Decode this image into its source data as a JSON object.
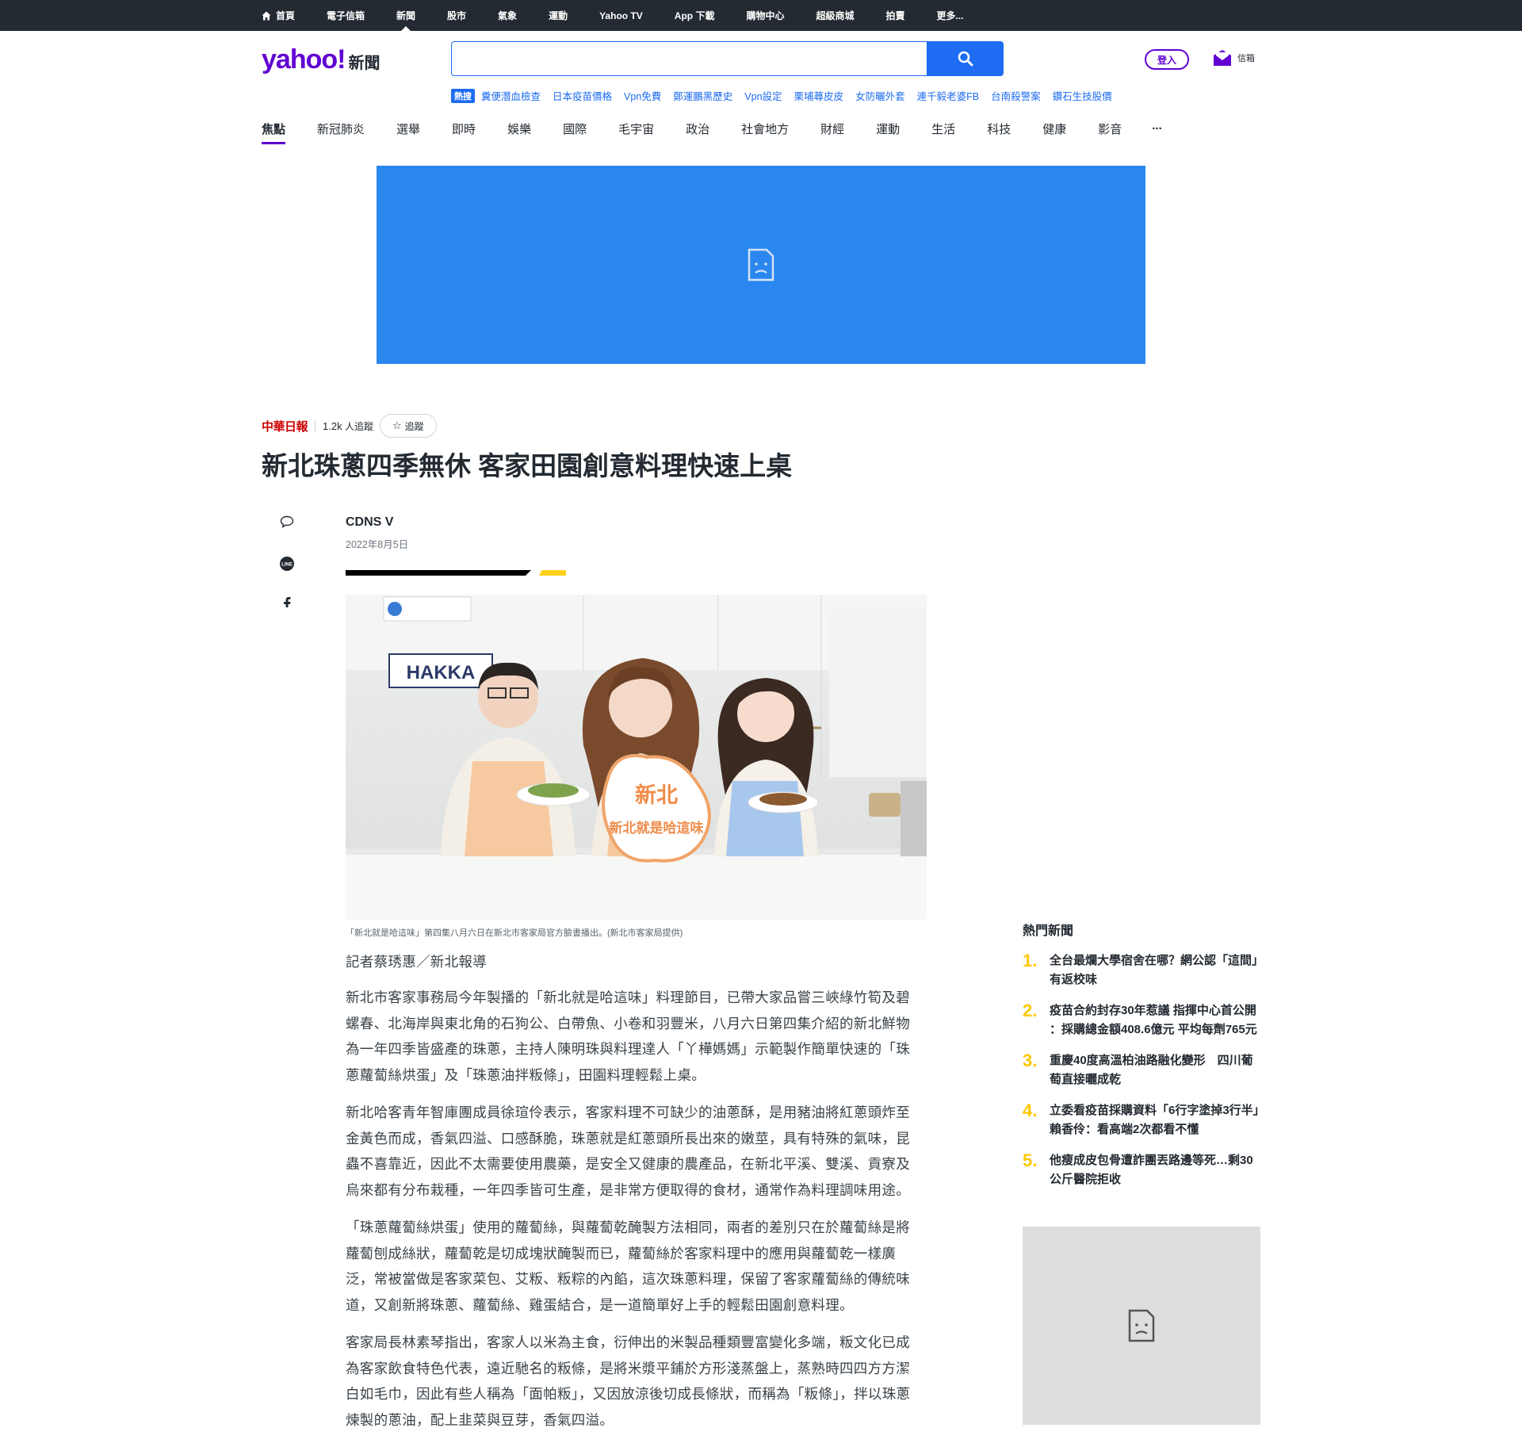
{
  "topnav": {
    "items": [
      "首頁",
      "電子信箱",
      "新聞",
      "股市",
      "氣象",
      "運動",
      "Yahoo TV",
      "App 下載",
      "購物中心",
      "超級商城",
      "拍賣",
      "更多..."
    ],
    "active_index": 2
  },
  "header": {
    "logo_yahoo": "yahoo!",
    "logo_section": "新聞",
    "search_placeholder": "",
    "login_label": "登入",
    "mail_label": "信箱"
  },
  "trending": {
    "badge": "熱搜",
    "links": [
      "糞便潛血檢查",
      "日本疫苗價格",
      "Vpn免費",
      "鄭運鵬黑歷史",
      "Vpn設定",
      "栗埔蕁皮皮",
      "女防曬外套",
      "連千毅老婆FB",
      "台南殺警案",
      "鑽石生技股價"
    ]
  },
  "categories": {
    "items": [
      "焦點",
      "新冠肺炎",
      "選舉",
      "即時",
      "娛樂",
      "國際",
      "毛宇宙",
      "政治",
      "社會地方",
      "財經",
      "運動",
      "生活",
      "科技",
      "健康",
      "影音"
    ],
    "active_index": 0,
    "more": "..."
  },
  "article": {
    "source_logo": "中華日報",
    "followers_count": "1.2k",
    "followers_suffix": "人追蹤",
    "follow_label": "追蹤",
    "headline": "新北珠蔥四季無休 客家田園創意料理快速上桌",
    "author": "CDNS V",
    "date": "2022年8月5日",
    "photo_sign_text": "HAKKA",
    "photo_board_text": "新北就是哈這味",
    "caption": "「新北就是哈這味」第四集八月六日在新北市客家局官方臉書播出。(新北市客家局提供)",
    "byline": "記者蔡琇惠／新北報導",
    "paragraphs": [
      "新北市客家事務局今年製播的「新北就是哈這味」料理節目，已帶大家品嘗三峽綠竹筍及碧螺春、北海岸與東北角的石狗公、白帶魚、小卷和羽豐米，八月六日第四集介紹的新北鮮物為一年四季皆盛產的珠蔥，主持人陳明珠與料理達人「丫樺媽媽」示範製作簡單快速的「珠蔥蘿蔔絲烘蛋」及「珠蔥油拌粄條」，田園料理輕鬆上桌。",
      "新北哈客青年智庫團成員徐瑄伶表示，客家料理不可缺少的油蔥酥，是用豬油將紅蔥頭炸至金黃色而成，香氣四溢、口感酥脆，珠蔥就是紅蔥頭所長出來的嫩莖，具有特殊的氣味，昆蟲不喜靠近，因此不太需要使用農藥，是安全又健康的農產品，在新北平溪、雙溪、貢寮及烏來都有分布栽種，一年四季皆可生產，是非常方便取得的食材，通常作為料理調味用途。",
      "「珠蔥蘿蔔絲烘蛋」使用的蘿蔔絲，與蘿蔔乾醃製方法相同，兩者的差別只在於蘿蔔絲是將蘿蔔刨成絲狀，蘿蔔乾是切成塊狀醃製而已，蘿蔔絲於客家料理中的應用與蘿蔔乾一樣廣泛，常被當做是客家菜包、艾粄、粄粽的內餡，這次珠蔥料理，保留了客家蘿蔔絲的傳統味道，又創新將珠蔥、蘿蔔絲、雞蛋結合，是一道簡單好上手的輕鬆田園創意料理。",
      "客家局長林素琴指出，客家人以米為主食，衍伸出的米製品種類豐富變化多端，粄文化已成為客家飲食特色代表，遠近馳名的粄條，是將米漿平鋪於方形淺蒸盤上，蒸熟時四四方方潔白如毛巾，因此有些人稱為「面帕粄」，又因放涼後切成長條狀，而稱為「粄條」，拌以珠蔥煉製的蔥油，配上韭菜與豆芽，香氣四溢。"
    ]
  },
  "popular": {
    "title": "熱門新聞",
    "items": [
      {
        "num": "1.",
        "text": "全台最爛大學宿舍在哪？網公認「這間」有返校味"
      },
      {
        "num": "2.",
        "text": "疫苗合約封存30年惹議 指揮中心首公開 ：採購總金額408.6億元 平均每劑765元"
      },
      {
        "num": "3.",
        "text": "重慶40度高溫柏油路融化變形　四川葡萄直接曬成乾"
      },
      {
        "num": "4.",
        "text": "立委看疫苗採購資料「6行字塗掉3行半」　賴香伶：看高端2次都看不懂"
      },
      {
        "num": "5.",
        "text": "他瘦成皮包骨遭詐團丟路邊等死…剩30公斤醫院拒收"
      }
    ]
  },
  "colors": {
    "brand_purple": "#6001d2",
    "accent_blue": "#1d6cf1",
    "ad_blue": "#2a87f0",
    "popular_number": "#ffc700",
    "bar_yellow": "#ffd11a"
  }
}
